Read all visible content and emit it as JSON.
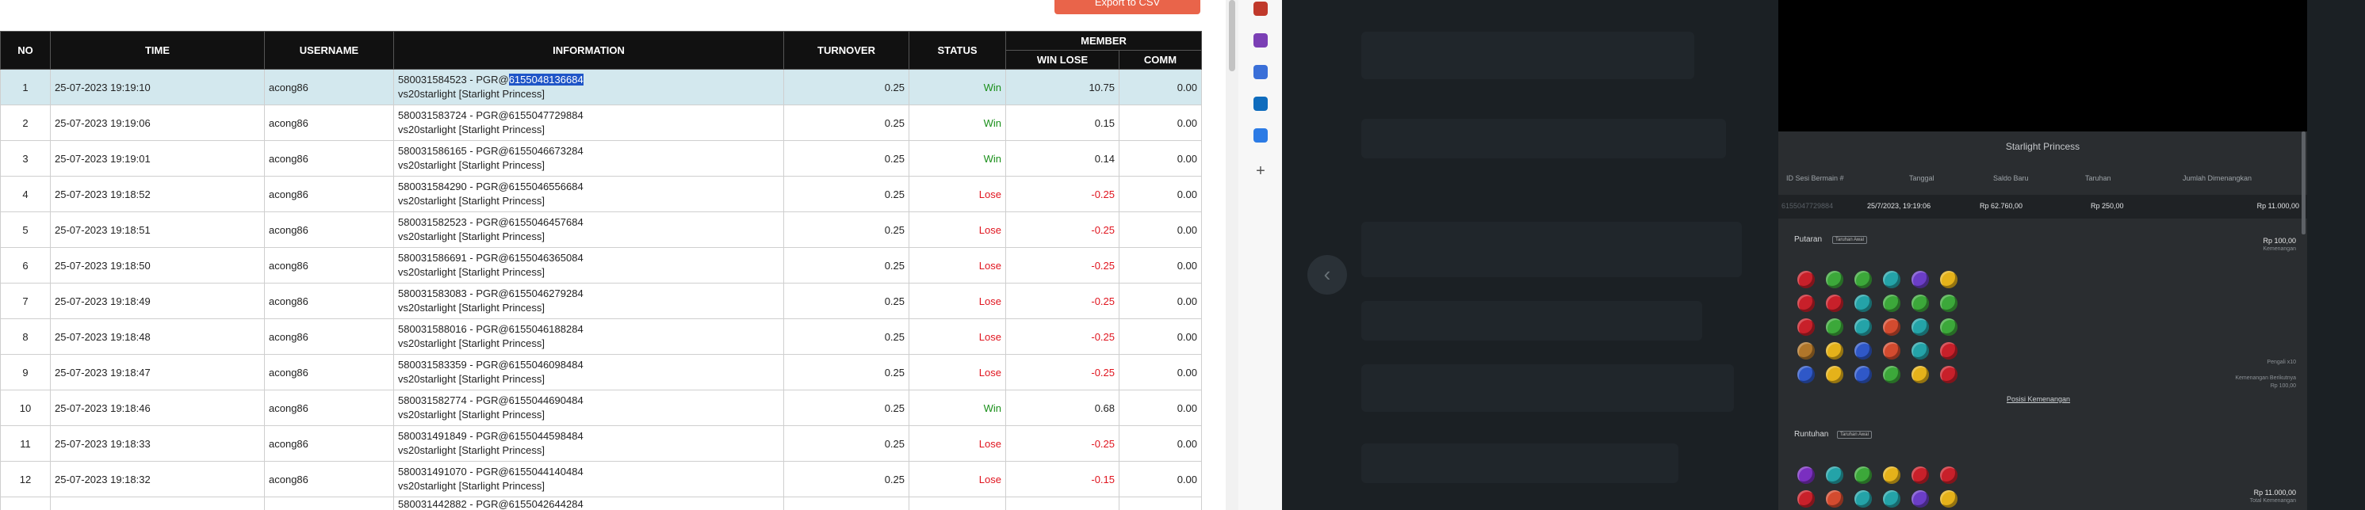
{
  "export_button": "Export to CSV",
  "table": {
    "headers": {
      "no": "NO",
      "time": "TIME",
      "username": "USERNAME",
      "information": "INFORMATION",
      "turnover": "TURNOVER",
      "status": "STATUS",
      "member": "MEMBER",
      "win_lose": "WIN LOSE",
      "comm": "COMM"
    },
    "rows": [
      {
        "no": "1",
        "time": "25-07-2023 19:19:10",
        "username": "acong86",
        "info_id_prefix": "580031584523 - PGR@",
        "info_id_highlight": "6155048136684",
        "info_game": "vs20starlight [Starlight Princess]",
        "turnover": "0.25",
        "status": "Win",
        "win_lose": "10.75",
        "comm": "0.00"
      },
      {
        "no": "2",
        "time": "25-07-2023 19:19:06",
        "username": "acong86",
        "info_id_prefix": "580031583724 - PGR@6155047729884",
        "info_id_highlight": "",
        "info_game": "vs20starlight [Starlight Princess]",
        "turnover": "0.25",
        "status": "Win",
        "win_lose": "0.15",
        "comm": "0.00"
      },
      {
        "no": "3",
        "time": "25-07-2023 19:19:01",
        "username": "acong86",
        "info_id_prefix": "580031586165 - PGR@6155046673284",
        "info_id_highlight": "",
        "info_game": "vs20starlight [Starlight Princess]",
        "turnover": "0.25",
        "status": "Win",
        "win_lose": "0.14",
        "comm": "0.00"
      },
      {
        "no": "4",
        "time": "25-07-2023 19:18:52",
        "username": "acong86",
        "info_id_prefix": "580031584290 - PGR@6155046556684",
        "info_id_highlight": "",
        "info_game": "vs20starlight [Starlight Princess]",
        "turnover": "0.25",
        "status": "Lose",
        "win_lose": "-0.25",
        "comm": "0.00"
      },
      {
        "no": "5",
        "time": "25-07-2023 19:18:51",
        "username": "acong86",
        "info_id_prefix": "580031582523 - PGR@6155046457684",
        "info_id_highlight": "",
        "info_game": "vs20starlight [Starlight Princess]",
        "turnover": "0.25",
        "status": "Lose",
        "win_lose": "-0.25",
        "comm": "0.00"
      },
      {
        "no": "6",
        "time": "25-07-2023 19:18:50",
        "username": "acong86",
        "info_id_prefix": "580031586691 - PGR@6155046365084",
        "info_id_highlight": "",
        "info_game": "vs20starlight [Starlight Princess]",
        "turnover": "0.25",
        "status": "Lose",
        "win_lose": "-0.25",
        "comm": "0.00"
      },
      {
        "no": "7",
        "time": "25-07-2023 19:18:49",
        "username": "acong86",
        "info_id_prefix": "580031583083 - PGR@6155046279284",
        "info_id_highlight": "",
        "info_game": "vs20starlight [Starlight Princess]",
        "turnover": "0.25",
        "status": "Lose",
        "win_lose": "-0.25",
        "comm": "0.00"
      },
      {
        "no": "8",
        "time": "25-07-2023 19:18:48",
        "username": "acong86",
        "info_id_prefix": "580031588016 - PGR@6155046188284",
        "info_id_highlight": "",
        "info_game": "vs20starlight [Starlight Princess]",
        "turnover": "0.25",
        "status": "Lose",
        "win_lose": "-0.25",
        "comm": "0.00"
      },
      {
        "no": "9",
        "time": "25-07-2023 19:18:47",
        "username": "acong86",
        "info_id_prefix": "580031583359 - PGR@6155046098484",
        "info_id_highlight": "",
        "info_game": "vs20starlight [Starlight Princess]",
        "turnover": "0.25",
        "status": "Lose",
        "win_lose": "-0.25",
        "comm": "0.00"
      },
      {
        "no": "10",
        "time": "25-07-2023 19:18:46",
        "username": "acong86",
        "info_id_prefix": "580031582774 - PGR@6155044690484",
        "info_id_highlight": "",
        "info_game": "vs20starlight [Starlight Princess]",
        "turnover": "0.25",
        "status": "Win",
        "win_lose": "0.68",
        "comm": "0.00"
      },
      {
        "no": "11",
        "time": "25-07-2023 19:18:33",
        "username": "acong86",
        "info_id_prefix": "580031491849 - PGR@6155044598484",
        "info_id_highlight": "",
        "info_game": "vs20starlight [Starlight Princess]",
        "turnover": "0.25",
        "status": "Lose",
        "win_lose": "-0.25",
        "comm": "0.00"
      },
      {
        "no": "12",
        "time": "25-07-2023 19:18:32",
        "username": "acong86",
        "info_id_prefix": "580031491070 - PGR@6155044140484",
        "info_id_highlight": "",
        "info_game": "vs20starlight [Starlight Princess]",
        "turnover": "0.25",
        "status": "Lose",
        "win_lose": "-0.15",
        "comm": "0.00"
      },
      {
        "no": "",
        "time": "",
        "username": "",
        "info_id_prefix": "580031442882 - PGR@6155042644284",
        "info_id_highlight": "",
        "info_game": "",
        "turnover": "",
        "status": "",
        "win_lose": "",
        "comm": "",
        "partial": true
      }
    ]
  },
  "sidebar_icons": [
    {
      "name": "toolbox-icon",
      "color": "#c0392b"
    },
    {
      "name": "people-icon",
      "color": "#7b3fb5"
    },
    {
      "name": "browser-extension-icon",
      "color": "#3a6fd8"
    },
    {
      "name": "outlook-icon",
      "color": "#0f6cbd"
    },
    {
      "name": "shopping-icon",
      "color": "#2c7be5"
    },
    {
      "name": "add-icon",
      "color": "#555555"
    }
  ],
  "game_history": {
    "title": "Starlight Princess",
    "columns": {
      "session": "ID Sesi Bermain #",
      "date": "Tanggal",
      "start_balance": "Saldo Baru",
      "bet": "Taruhan",
      "wins": "Jumlah Dimenangkan"
    },
    "row": {
      "session": "6155047729884",
      "date": "25/7/2023, 19:19:06",
      "start_balance": "Rp 62.760,00",
      "bet": "Rp 250,00",
      "wins": "Rp 11.000,00"
    },
    "spin_section": {
      "label": "Putaran",
      "tag": "Taruhan Awal",
      "amount": "Rp 100,00",
      "amount_sub": "Kemenangan"
    },
    "payout_link": "Posisi Kemenangan",
    "multiplier_note": "Pengali x10",
    "total_note": "Kemenangan Berikutnya",
    "total_note_value": "Rp 100,00",
    "tumble_section": {
      "label": "Runtuhan",
      "tag": "Taruhan Awal",
      "amount": "Rp 11.000,00",
      "amount_sub": "Total Kemenangan"
    },
    "symbol_colors": {
      "red": "#c8202a",
      "green": "#3ca83a",
      "teal": "#24a3a8",
      "purple": "#6b3ec7",
      "yellow": "#e5b21a",
      "blue": "#2f58c8",
      "crown": "#b0762a",
      "pink": "#d34b2f",
      "orb": "#7a2fc0"
    },
    "grid1": [
      [
        "red",
        "green",
        "green",
        "teal",
        "purple",
        "yellow"
      ],
      [
        "red",
        "red",
        "teal",
        "green",
        "green",
        "green"
      ],
      [
        "red",
        "green",
        "teal",
        "pink",
        "teal",
        "green"
      ],
      [
        "crown",
        "yellow",
        "blue",
        "pink",
        "teal",
        "red"
      ],
      [
        "blue",
        "yellow",
        "blue",
        "green",
        "yellow",
        "red"
      ]
    ],
    "grid2": [
      [
        "orb",
        "teal",
        "green",
        "yellow",
        "red",
        "red"
      ],
      [
        "red",
        "pink",
        "teal",
        "teal",
        "purple",
        "yellow"
      ]
    ]
  }
}
